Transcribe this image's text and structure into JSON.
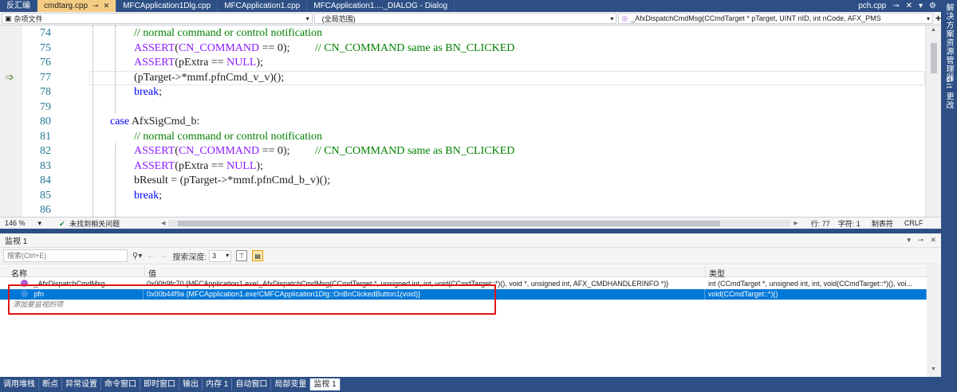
{
  "tabs": [
    {
      "label": "反汇编",
      "active": false,
      "closable": false
    },
    {
      "label": "cmdtarg.cpp",
      "active": true,
      "closable": true
    },
    {
      "label": "MFCApplication1Dlg.cpp",
      "active": false,
      "closable": false
    },
    {
      "label": "MFCApplication1.cpp",
      "active": false,
      "closable": false
    },
    {
      "label": "MFCApplication1...._DIALOG - Dialog",
      "active": false,
      "closable": false
    }
  ],
  "tab_right": {
    "file": "pch.cpp"
  },
  "sidebar_labels": [
    "解决方案资源管理器",
    "Git 更改"
  ],
  "navbar": {
    "project": "杂项文件",
    "scope": "(全局范围)",
    "member": "_AfxDispatchCmdMsg(CCmdTarget * pTarget, UINT nID, int nCode, AFX_PMS"
  },
  "code_lines": [
    {
      "num": "74",
      "indent": 1,
      "parts": [
        {
          "t": "// normal command or control notification",
          "c": "cm"
        }
      ]
    },
    {
      "num": "75",
      "indent": 1,
      "parts": [
        {
          "t": "ASSERT",
          "c": "mac"
        },
        {
          "t": "(",
          "c": ""
        },
        {
          "t": "CN_COMMAND",
          "c": "mac"
        },
        {
          "t": " == 0);         ",
          "c": ""
        },
        {
          "t": "// CN_COMMAND same as BN_CLICKED",
          "c": "cm"
        }
      ]
    },
    {
      "num": "76",
      "indent": 1,
      "parts": [
        {
          "t": "ASSERT",
          "c": "mac"
        },
        {
          "t": "(pExtra == ",
          "c": ""
        },
        {
          "t": "NULL",
          "c": "mac"
        },
        {
          "t": ");",
          "c": ""
        }
      ]
    },
    {
      "num": "77",
      "indent": 1,
      "parts": [
        {
          "t": "(pTarget->*mmf.pfnCmd_v_v)();",
          "c": ""
        }
      ]
    },
    {
      "num": "78",
      "indent": 1,
      "parts": [
        {
          "t": "break",
          "c": "kw"
        },
        {
          "t": ";",
          "c": ""
        }
      ]
    },
    {
      "num": "79",
      "indent": 0,
      "parts": []
    },
    {
      "num": "80",
      "indent": 0,
      "parts": [
        {
          "t": "case",
          "c": "kw"
        },
        {
          "t": " AfxSigCmd_b:",
          "c": ""
        }
      ]
    },
    {
      "num": "81",
      "indent": 1,
      "parts": [
        {
          "t": "// normal command or control notification",
          "c": "cm"
        }
      ]
    },
    {
      "num": "82",
      "indent": 1,
      "parts": [
        {
          "t": "ASSERT",
          "c": "mac"
        },
        {
          "t": "(",
          "c": ""
        },
        {
          "t": "CN_COMMAND",
          "c": "mac"
        },
        {
          "t": " == 0);         ",
          "c": ""
        },
        {
          "t": "// CN_COMMAND same as BN_CLICKED",
          "c": "cm"
        }
      ]
    },
    {
      "num": "83",
      "indent": 1,
      "parts": [
        {
          "t": "ASSERT",
          "c": "mac"
        },
        {
          "t": "(pExtra == ",
          "c": ""
        },
        {
          "t": "NULL",
          "c": "mac"
        },
        {
          "t": ");",
          "c": ""
        }
      ]
    },
    {
      "num": "84",
      "indent": 1,
      "parts": [
        {
          "t": "bResult = (pTarget->*mmf.pfnCmd_b_v)();",
          "c": ""
        }
      ]
    },
    {
      "num": "85",
      "indent": 1,
      "parts": [
        {
          "t": "break",
          "c": "kw"
        },
        {
          "t": ";",
          "c": ""
        }
      ]
    },
    {
      "num": "86",
      "indent": 0,
      "parts": []
    }
  ],
  "editor_status": {
    "zoom": "146 %",
    "issues": "未找到相关问题",
    "line": "行: 77",
    "col": "字符: 1",
    "tabs": "制表符",
    "eol": "CRLF"
  },
  "watch": {
    "title": "监视 1",
    "search_placeholder": "搜索(Ctrl+E)",
    "depth_label": "搜索深度:",
    "depth_value": "3",
    "columns": [
      "名称",
      "值",
      "类型"
    ],
    "rows": [
      {
        "name": "_AfxDispatchCmdMsg",
        "value": "0x00b9fc70 {MFCApplication1.exe!_AfxDispatchCmdMsg(CCmdTarget *, unsigned int, int, void(CCmdTarget::*)(), void *, unsigned int, AFX_CMDHANDLERINFO *)}",
        "type": "int (CCmdTarget *, unsigned int, int, void(CCmdTarget::*)(), voi...",
        "selected": false,
        "icon_color": "#b05fd0"
      },
      {
        "name": "pfn",
        "value": "0x00b44f9a {MFCApplication1.exe!CMFCApplication1Dlg::OnBnClickedButton1(void)}",
        "type": "void(CCmdTarget::*)()",
        "selected": true,
        "icon_color": "#3d8ee0"
      }
    ],
    "add_item": "添加要监视的项"
  },
  "bottom_tabs": [
    {
      "label": "调用堆栈",
      "active": false
    },
    {
      "label": "断点",
      "active": false
    },
    {
      "label": "异常设置",
      "active": false
    },
    {
      "label": "命令窗口",
      "active": false
    },
    {
      "label": "即时窗口",
      "active": false
    },
    {
      "label": "输出",
      "active": false
    },
    {
      "label": "内存 1",
      "active": false
    },
    {
      "label": "自动窗口",
      "active": false
    },
    {
      "label": "局部变量",
      "active": false
    },
    {
      "label": "监视 1",
      "active": true
    }
  ],
  "colors": {
    "accent": "#2d4f86",
    "active_tab": "#f5cc84",
    "selection": "#0078d7",
    "highlight_box": "#e21414"
  }
}
